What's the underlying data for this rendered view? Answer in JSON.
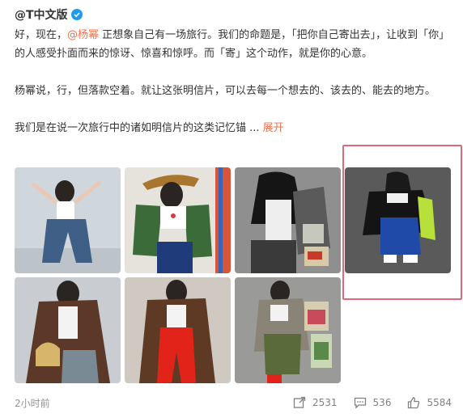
{
  "post": {
    "author": "@T中文版",
    "mention": "@杨幂",
    "para1_start": "好，现在，",
    "para1_rest": " 正想象自己有一场旅行。我们的命题是，「把你自己寄出去」，让收到「你」的人感受扑面而来的惊讶、惊喜和惊呼。而「寄」这个动作，就是你的心意。",
    "para2": "杨幂说，行，但落款空着。就让这张明信片，可以去每一个想去的、该去的、能去的地方。",
    "para3": "我们是在说一次旅行中的诸如明信片的这类记忆锚 ...",
    "expand_label": "展开",
    "time": "2小时前",
    "reposts": "2531",
    "comments": "536",
    "likes": "5584"
  },
  "colors": {
    "link": "#eb7350",
    "highlight": "#e06a77",
    "verified": "#1d9bf0"
  },
  "icons": [
    "verified-badge-icon",
    "repost-icon",
    "comment-icon",
    "like-icon"
  ]
}
